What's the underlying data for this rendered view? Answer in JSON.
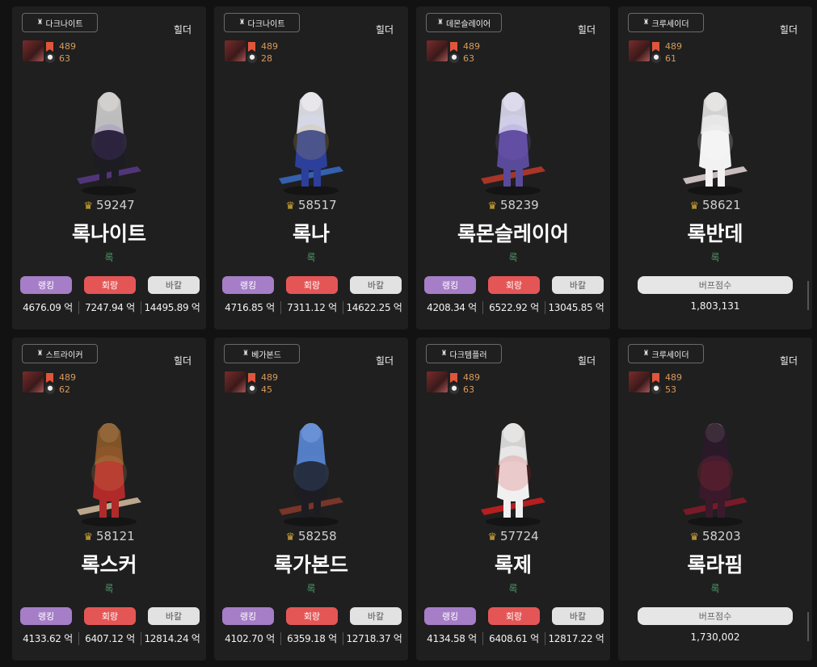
{
  "cards": [
    {
      "server": "다크나이트",
      "role": "힐더",
      "stat1": "489",
      "stat2": "63",
      "score": "59247",
      "name": "록나이트",
      "sub": "록",
      "type": "dealer",
      "rank_label": "랭킹",
      "eva_label": "회랑",
      "bak_label": "바칼",
      "rank_val": "4676.09 억",
      "eva_val": "7247.94 억",
      "bak_val": "14495.89 억",
      "sprite": {
        "robe": "#1c1c22",
        "hair": "#cfcfcf",
        "weapon": "#5a3a8a",
        "glow": "#7a4cc0"
      }
    },
    {
      "server": "다크나이트",
      "role": "힐더",
      "stat1": "489",
      "stat2": "28",
      "score": "58517",
      "name": "록나",
      "sub": "록",
      "type": "dealer",
      "rank_label": "랭킹",
      "eva_label": "회랑",
      "bak_label": "바칼",
      "rank_val": "4716.85 억",
      "eva_val": "7311.12 억",
      "bak_val": "14622.25 억",
      "sprite": {
        "robe": "#2c3f9a",
        "hair": "#e8e8f0",
        "weapon": "#3a6cc8",
        "glow": "#d6b64a"
      }
    },
    {
      "server": "데몬슬레이어",
      "role": "힐더",
      "stat1": "489",
      "stat2": "63",
      "score": "58239",
      "name": "록몬슬레이어",
      "sub": "록",
      "type": "dealer",
      "rank_label": "랭킹",
      "eva_label": "회랑",
      "bak_label": "바칼",
      "rank_val": "4208.34 억",
      "eva_val": "6522.92 억",
      "bak_val": "13045.85 억",
      "sprite": {
        "robe": "#5a4a9a",
        "hair": "#dcdcf0",
        "weapon": "#c03a2a",
        "glow": "#8a6ad0"
      }
    },
    {
      "server": "크루세이더",
      "role": "힐더",
      "stat1": "489",
      "stat2": "61",
      "score": "58621",
      "name": "록반데",
      "sub": "록",
      "type": "buffer",
      "buff_label": "버프점수",
      "buff_val": "1,803,131",
      "sprite": {
        "robe": "#f2f2f2",
        "hair": "#e6e6e6",
        "weapon": "#e8d8d8",
        "glow": "#ffffff"
      }
    },
    {
      "server": "스트라이커",
      "role": "힐더",
      "stat1": "489",
      "stat2": "62",
      "score": "58121",
      "name": "록스커",
      "sub": "록",
      "type": "dealer",
      "rank_label": "랭킹",
      "eva_label": "회랑",
      "bak_label": "바칼",
      "rank_val": "4133.62 억",
      "eva_val": "6407.12 억",
      "bak_val": "12814.24 억",
      "sprite": {
        "robe": "#b02a2a",
        "hair": "#8a5a2a",
        "weapon": "#d8c0a0",
        "glow": "#e4a060"
      }
    },
    {
      "server": "베가본드",
      "role": "힐더",
      "stat1": "489",
      "stat2": "45",
      "score": "58258",
      "name": "록가본드",
      "sub": "록",
      "type": "dealer",
      "rank_label": "랭킹",
      "eva_label": "회랑",
      "bak_label": "바칼",
      "rank_val": "4102.70 억",
      "eva_val": "6359.18 억",
      "bak_val": "12718.37 억",
      "sprite": {
        "robe": "#1c1c22",
        "hair": "#5a8ad8",
        "weapon": "#8a3a2a",
        "glow": "#5a8ad8"
      }
    },
    {
      "server": "다크템플러",
      "role": "힐더",
      "stat1": "489",
      "stat2": "63",
      "score": "57724",
      "name": "록제",
      "sub": "록",
      "type": "dealer",
      "rank_label": "랭킹",
      "eva_label": "회랑",
      "bak_label": "바칼",
      "rank_val": "4134.58 억",
      "eva_val": "6408.61 억",
      "bak_val": "12817.22 억",
      "sprite": {
        "robe": "#f0f0f0",
        "hair": "#e6e6e6",
        "weapon": "#d02020",
        "glow": "#d02020"
      }
    },
    {
      "server": "크루세이더",
      "role": "힐더",
      "stat1": "489",
      "stat2": "53",
      "score": "58203",
      "name": "록라핌",
      "sub": "록",
      "type": "buffer",
      "buff_label": "버프점수",
      "buff_val": "1,730,002",
      "sprite": {
        "robe": "#3a1a2a",
        "hair": "#2a1a2a",
        "weapon": "#8a1a2a",
        "glow": "#c03040"
      }
    }
  ]
}
